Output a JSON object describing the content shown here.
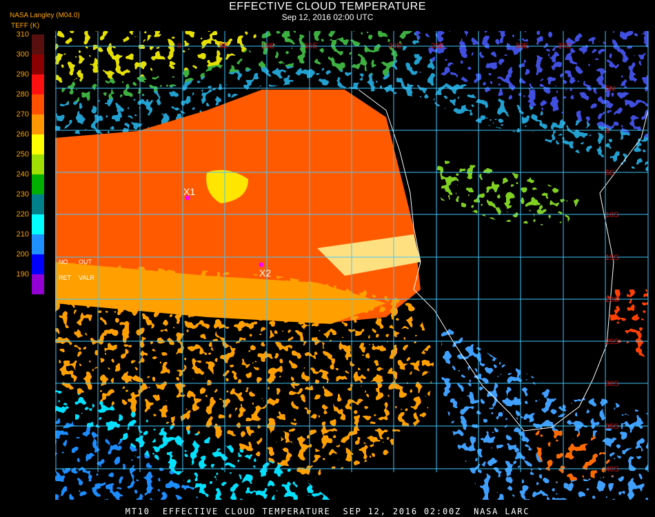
{
  "header": {
    "title": "EFFECTIVE CLOUD TEMPERATURE",
    "subtitle": "Sep 12, 2016 02:00 UTC",
    "producer": "NASA Langley (M04.0)",
    "units": "TEFF (K)"
  },
  "colorbar": {
    "ticks": [
      "310",
      "300",
      "290",
      "280",
      "270",
      "260",
      "250",
      "240",
      "230",
      "220",
      "210",
      "200",
      "190"
    ],
    "colors": [
      "#5a0f0f",
      "#8b0000",
      "#ff1010",
      "#ff5000",
      "#ff9800",
      "#ffff00",
      "#a0e000",
      "#00b000",
      "#00808a",
      "#00ffff",
      "#1e90ff",
      "#0000ff",
      "#9400d3"
    ]
  },
  "legend": {
    "no_label": "NO",
    "out_label": "OUT",
    "ret_label": "RET",
    "valr_label": "VALR"
  },
  "grid": {
    "top_labels": [
      "0",
      "5E",
      "10E",
      "15E",
      "20E",
      "25E",
      "30E",
      "35E"
    ],
    "right_labels": [
      "5N",
      "0",
      "5S",
      "10S",
      "15S",
      "20S",
      "25S",
      "30S",
      "35S",
      "40S"
    ],
    "color": "#40c8ff",
    "label_color": "#c81414"
  },
  "markers": [
    {
      "label": "X1",
      "color": "#ff00ff"
    },
    {
      "label": "X2",
      "color": "#ff00ff"
    }
  ],
  "footer": "MT10  EFFECTIVE CLOUD TEMPERATURE  SEP 12, 2016 02:00Z  NASA LARC"
}
